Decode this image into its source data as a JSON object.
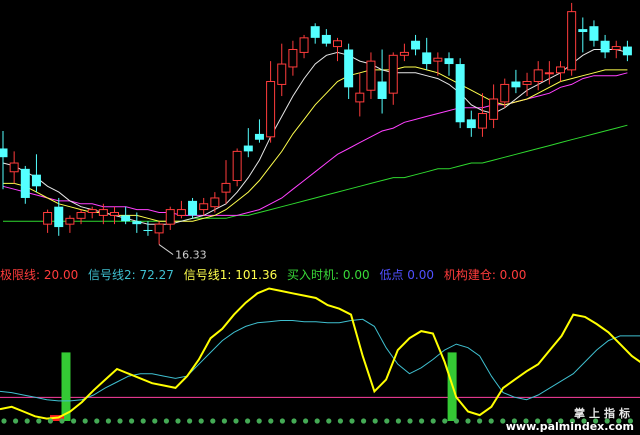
{
  "colors": {
    "bg": "#000000",
    "up_candle": "#ff3c3c",
    "down_candle": "#54ffff",
    "ma_white": "#e6e6e6",
    "ma_yellow": "#ffff4d",
    "ma_magenta": "#ff40ff",
    "ma_green": "#2fd92f",
    "signal1": "#ffff00",
    "signal2": "#3fbfcf",
    "build_bar": "#34c934",
    "baseline": "#ff3fa0",
    "dots": "#44aa55"
  },
  "legend": {
    "line1_label": "极限线: 20.00",
    "line2_label": "信号线2: 72.27",
    "line3_label": "信号线1: 101.36",
    "line4_label": "买入时机: 0.00",
    "line5_label": "低点  0.00",
    "line6_label": "机构建仓: 0.00"
  },
  "annotation": {
    "low_label": "16.33"
  },
  "watermark": {
    "cn": "掌上指标",
    "url": "www.palmindex.com"
  },
  "chart_data": [
    {
      "type": "candlestick",
      "title": "",
      "low_annotation": 16.33,
      "ylim": [
        16.0,
        25.0
      ],
      "candles": [
        {
          "o": 19.9,
          "h": 20.5,
          "l": 18.5,
          "c": 19.6,
          "up": false
        },
        {
          "o": 19.1,
          "h": 19.8,
          "l": 18.7,
          "c": 19.4,
          "up": true
        },
        {
          "o": 19.2,
          "h": 19.3,
          "l": 18.0,
          "c": 18.2,
          "up": false
        },
        {
          "o": 19.0,
          "h": 19.7,
          "l": 18.4,
          "c": 18.6,
          "up": false
        },
        {
          "o": 17.3,
          "h": 17.8,
          "l": 17.0,
          "c": 17.7,
          "up": true
        },
        {
          "o": 17.9,
          "h": 18.2,
          "l": 16.9,
          "c": 17.2,
          "up": false
        },
        {
          "o": 17.3,
          "h": 17.6,
          "l": 17.0,
          "c": 17.5,
          "up": true
        },
        {
          "o": 17.5,
          "h": 17.8,
          "l": 17.3,
          "c": 17.7,
          "up": true
        },
        {
          "o": 17.7,
          "h": 17.9,
          "l": 17.5,
          "c": 17.8,
          "up": true
        },
        {
          "o": 17.6,
          "h": 18.0,
          "l": 17.3,
          "c": 17.8,
          "up": true
        },
        {
          "o": 17.6,
          "h": 17.9,
          "l": 17.3,
          "c": 17.7,
          "up": true
        },
        {
          "o": 17.6,
          "h": 17.9,
          "l": 17.3,
          "c": 17.4,
          "up": false
        },
        {
          "o": 17.4,
          "h": 17.7,
          "l": 17.0,
          "c": 17.3,
          "up": false
        },
        {
          "o": 17.1,
          "h": 17.4,
          "l": 16.9,
          "c": 17.1,
          "up": false
        },
        {
          "o": 17.0,
          "h": 17.4,
          "l": 16.6,
          "c": 17.3,
          "up": true
        },
        {
          "o": 17.3,
          "h": 17.9,
          "l": 17.1,
          "c": 17.8,
          "up": true
        },
        {
          "o": 17.6,
          "h": 18.1,
          "l": 17.5,
          "c": 17.8,
          "up": true
        },
        {
          "o": 18.1,
          "h": 18.2,
          "l": 17.5,
          "c": 17.6,
          "up": false
        },
        {
          "o": 17.8,
          "h": 18.2,
          "l": 17.6,
          "c": 18.0,
          "up": true
        },
        {
          "o": 17.9,
          "h": 18.4,
          "l": 17.7,
          "c": 18.2,
          "up": true
        },
        {
          "o": 18.4,
          "h": 19.5,
          "l": 18.0,
          "c": 18.7,
          "up": true
        },
        {
          "o": 18.8,
          "h": 19.9,
          "l": 18.6,
          "c": 19.8,
          "up": true
        },
        {
          "o": 20.0,
          "h": 20.6,
          "l": 19.6,
          "c": 19.8,
          "up": false
        },
        {
          "o": 20.4,
          "h": 20.9,
          "l": 20.1,
          "c": 20.2,
          "up": false
        },
        {
          "o": 20.3,
          "h": 22.9,
          "l": 20.1,
          "c": 22.2,
          "up": true
        },
        {
          "o": 22.1,
          "h": 23.5,
          "l": 21.7,
          "c": 22.8,
          "up": true
        },
        {
          "o": 22.7,
          "h": 23.6,
          "l": 22.4,
          "c": 23.3,
          "up": true
        },
        {
          "o": 23.2,
          "h": 23.8,
          "l": 23.0,
          "c": 23.7,
          "up": true
        },
        {
          "o": 24.1,
          "h": 24.2,
          "l": 23.5,
          "c": 23.7,
          "up": false
        },
        {
          "o": 23.8,
          "h": 24.0,
          "l": 23.4,
          "c": 23.5,
          "up": false
        },
        {
          "o": 23.4,
          "h": 23.7,
          "l": 22.9,
          "c": 23.6,
          "up": true
        },
        {
          "o": 23.3,
          "h": 23.5,
          "l": 21.6,
          "c": 22.0,
          "up": false
        },
        {
          "o": 21.5,
          "h": 22.5,
          "l": 21.0,
          "c": 21.8,
          "up": true
        },
        {
          "o": 21.9,
          "h": 23.2,
          "l": 21.6,
          "c": 22.9,
          "up": true
        },
        {
          "o": 22.2,
          "h": 23.3,
          "l": 21.1,
          "c": 21.6,
          "up": false
        },
        {
          "o": 21.8,
          "h": 23.2,
          "l": 21.4,
          "c": 23.1,
          "up": true
        },
        {
          "o": 23.1,
          "h": 23.5,
          "l": 22.9,
          "c": 23.2,
          "up": true
        },
        {
          "o": 23.3,
          "h": 23.8,
          "l": 23.1,
          "c": 23.6,
          "up": false
        },
        {
          "o": 23.2,
          "h": 23.7,
          "l": 22.6,
          "c": 22.8,
          "up": false
        },
        {
          "o": 22.9,
          "h": 23.2,
          "l": 22.4,
          "c": 23.0,
          "up": true
        },
        {
          "o": 23.0,
          "h": 23.2,
          "l": 22.4,
          "c": 22.8,
          "up": false
        },
        {
          "o": 22.8,
          "h": 23.0,
          "l": 20.6,
          "c": 20.8,
          "up": false
        },
        {
          "o": 20.9,
          "h": 21.2,
          "l": 20.3,
          "c": 20.6,
          "up": false
        },
        {
          "o": 20.6,
          "h": 21.8,
          "l": 20.3,
          "c": 21.1,
          "up": true
        },
        {
          "o": 20.9,
          "h": 22.1,
          "l": 20.6,
          "c": 21.6,
          "up": true
        },
        {
          "o": 21.5,
          "h": 22.3,
          "l": 21.3,
          "c": 22.1,
          "up": true
        },
        {
          "o": 22.2,
          "h": 22.6,
          "l": 21.8,
          "c": 22.0,
          "up": false
        },
        {
          "o": 22.1,
          "h": 22.5,
          "l": 21.7,
          "c": 22.2,
          "up": true
        },
        {
          "o": 22.2,
          "h": 22.9,
          "l": 21.9,
          "c": 22.6,
          "up": true
        },
        {
          "o": 22.5,
          "h": 22.9,
          "l": 22.1,
          "c": 22.5,
          "up": true
        },
        {
          "o": 22.5,
          "h": 22.9,
          "l": 22.2,
          "c": 22.7,
          "up": true
        },
        {
          "o": 22.6,
          "h": 24.9,
          "l": 22.4,
          "c": 24.6,
          "up": true
        },
        {
          "o": 24.0,
          "h": 24.4,
          "l": 23.2,
          "c": 23.9,
          "up": false
        },
        {
          "o": 24.1,
          "h": 24.3,
          "l": 23.4,
          "c": 23.6,
          "up": false
        },
        {
          "o": 23.6,
          "h": 23.8,
          "l": 23.0,
          "c": 23.2,
          "up": false
        },
        {
          "o": 23.3,
          "h": 23.6,
          "l": 23.0,
          "c": 23.4,
          "up": true
        },
        {
          "o": 23.4,
          "h": 23.6,
          "l": 22.9,
          "c": 23.1,
          "up": false
        }
      ],
      "ma_white": [
        19.4,
        19.3,
        19.1,
        18.9,
        18.6,
        18.4,
        18.1,
        17.9,
        17.8,
        17.7,
        17.6,
        17.5,
        17.4,
        17.3,
        17.3,
        17.3,
        17.4,
        17.5,
        17.6,
        17.8,
        18.0,
        18.4,
        18.9,
        19.5,
        20.3,
        21.0,
        21.7,
        22.3,
        22.8,
        23.1,
        23.2,
        23.1,
        22.9,
        22.8,
        22.6,
        22.5,
        22.5,
        22.5,
        22.4,
        22.3,
        22.1,
        21.8,
        21.4,
        21.2,
        21.1,
        21.3,
        21.6,
        21.9,
        22.1,
        22.3,
        22.5,
        22.8,
        23.1,
        23.3,
        23.3,
        23.3,
        23.2
      ],
      "ma_yellow": [
        18.7,
        18.7,
        18.6,
        18.4,
        18.2,
        18.0,
        17.9,
        17.8,
        17.7,
        17.7,
        17.6,
        17.6,
        17.6,
        17.5,
        17.4,
        17.4,
        17.4,
        17.4,
        17.5,
        17.6,
        17.8,
        18.1,
        18.4,
        18.8,
        19.3,
        19.8,
        20.4,
        20.9,
        21.4,
        21.8,
        22.2,
        22.4,
        22.5,
        22.6,
        22.6,
        22.6,
        22.7,
        22.7,
        22.6,
        22.5,
        22.3,
        22.1,
        21.9,
        21.7,
        21.5,
        21.4,
        21.5,
        21.6,
        21.8,
        22.0,
        22.2,
        22.3,
        22.4,
        22.5,
        22.6,
        22.6,
        22.6
      ],
      "ma_magenta": [
        18.6,
        18.5,
        18.4,
        18.3,
        18.2,
        18.1,
        18.1,
        18.0,
        18.0,
        17.9,
        17.9,
        17.9,
        17.8,
        17.8,
        17.7,
        17.7,
        17.6,
        17.6,
        17.6,
        17.6,
        17.6,
        17.6,
        17.7,
        17.8,
        18.0,
        18.2,
        18.5,
        18.8,
        19.1,
        19.4,
        19.7,
        19.9,
        20.1,
        20.3,
        20.5,
        20.6,
        20.8,
        20.9,
        21.0,
        21.1,
        21.2,
        21.3,
        21.3,
        21.3,
        21.4,
        21.4,
        21.5,
        21.6,
        21.7,
        21.8,
        22.0,
        22.1,
        22.3,
        22.4,
        22.4,
        22.4,
        22.5
      ],
      "ma_green": [
        17.4,
        17.4,
        17.4,
        17.4,
        17.4,
        17.4,
        17.4,
        17.4,
        17.4,
        17.4,
        17.4,
        17.4,
        17.4,
        17.4,
        17.4,
        17.4,
        17.4,
        17.5,
        17.5,
        17.5,
        17.5,
        17.6,
        17.6,
        17.7,
        17.8,
        17.9,
        18.0,
        18.1,
        18.2,
        18.3,
        18.4,
        18.5,
        18.6,
        18.7,
        18.8,
        18.9,
        18.9,
        19.0,
        19.1,
        19.2,
        19.2,
        19.3,
        19.4,
        19.4,
        19.5,
        19.6,
        19.7,
        19.8,
        19.9,
        20.0,
        20.1,
        20.2,
        20.3,
        20.4,
        20.5,
        20.6,
        20.7
      ]
    },
    {
      "type": "line",
      "title": "",
      "ylim": [
        0,
        115
      ],
      "series": [
        {
          "name": "极限线",
          "value": 20.0
        },
        {
          "name": "信号线2",
          "last": 72.27,
          "values": [
            25,
            24,
            22,
            20,
            18,
            17,
            17,
            18,
            22,
            28,
            33,
            38,
            40,
            40,
            38,
            36,
            38,
            48,
            58,
            68,
            75,
            80,
            83,
            84,
            85,
            85,
            84,
            84,
            83,
            83,
            85,
            86,
            80,
            62,
            48,
            40,
            45,
            52,
            60,
            65,
            62,
            55,
            38,
            24,
            20,
            18,
            22,
            28,
            34,
            40,
            50,
            60,
            68,
            72,
            72,
            72
          ]
        },
        {
          "name": "信号线1",
          "last": 101.36,
          "values": [
            10,
            12,
            8,
            4,
            2,
            3,
            8,
            16,
            26,
            35,
            44,
            40,
            36,
            32,
            30,
            28,
            38,
            52,
            70,
            78,
            90,
            100,
            108,
            112,
            110,
            108,
            106,
            104,
            98,
            95,
            90,
            55,
            25,
            35,
            60,
            70,
            76,
            74,
            50,
            20,
            8,
            5,
            12,
            28,
            35,
            42,
            48,
            60,
            72,
            90,
            88,
            82,
            75,
            65,
            55,
            48
          ]
        },
        {
          "name": "机构建仓",
          "last": 0.0,
          "bars": [
            {
              "i": 5,
              "v": 58
            },
            {
              "i": 38,
              "v": 58
            }
          ]
        }
      ]
    }
  ]
}
